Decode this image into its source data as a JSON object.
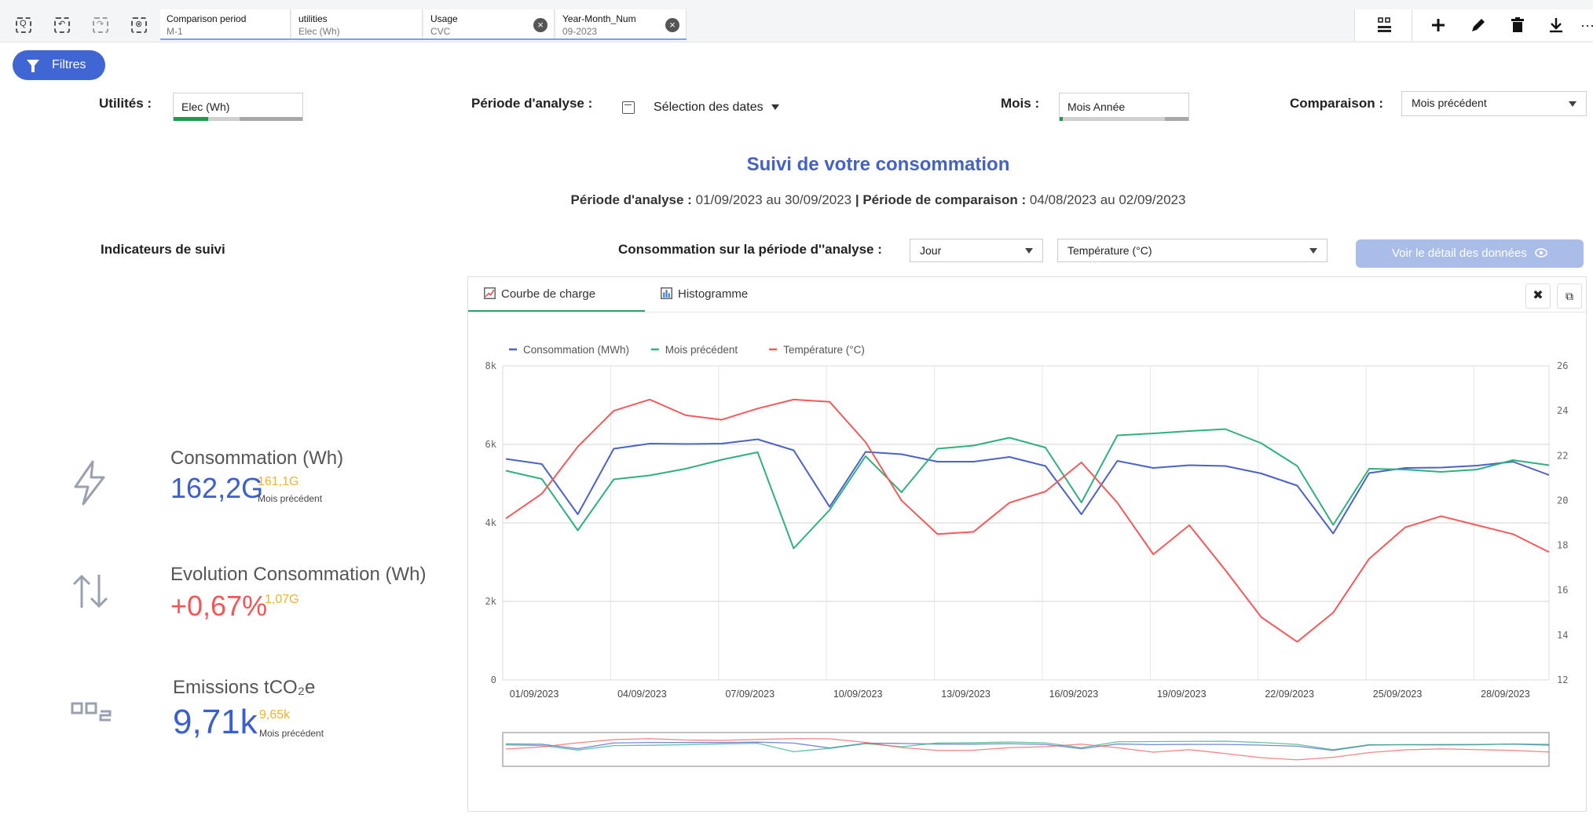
{
  "toolbar": {
    "chips": [
      {
        "key": "Comparison period",
        "value": "M-1",
        "closable": false
      },
      {
        "key": "utilities",
        "value": "Elec (Wh)",
        "closable": false
      },
      {
        "key": "Usage",
        "value": "CVC",
        "closable": true
      },
      {
        "key": "Year-Month_Num",
        "value": "09-2023",
        "closable": true
      }
    ],
    "right_icons": [
      "bookmark-grid-icon",
      "plus-icon",
      "pencil-icon",
      "trash-icon",
      "download-icon",
      "more-icon"
    ],
    "more_glyph": "···"
  },
  "filters_button": {
    "label": "Filtres"
  },
  "filter_row": {
    "utilities_label": "Utilités :",
    "utilities_value": "Elec (Wh)",
    "period_label": "Période d'analyse :",
    "period_value": "Sélection des dates",
    "month_label": "Mois :",
    "month_value": "Mois Année",
    "comparison_label": "Comparaison :",
    "comparison_value": "Mois précédent"
  },
  "header": {
    "title": "Suivi de votre consommation",
    "analysis_label": "Période d'analyse :",
    "analysis_range": "01/09/2023 au 30/09/2023",
    "separator": "|",
    "comparison_label": "Période de comparaison :",
    "comparison_range": "04/08/2023 au 02/09/2023"
  },
  "indicators": {
    "section_title": "Indicateurs de suivi",
    "kpis": [
      {
        "title": "Consommation (Wh)",
        "value": "162,2G",
        "value_color": "#3b5fcf",
        "compare": "161,1G",
        "sub": "Mois précédent",
        "icon": "lightning-icon"
      },
      {
        "title": "Evolution Consommation (Wh)",
        "value": "+0,67%",
        "value_color": "#f25656",
        "compare": "1,07G",
        "sub": "",
        "icon": "arrows-up-down-icon"
      },
      {
        "title": "Emissions tCO₂e",
        "value": "9,71k",
        "value_color": "#3b5fcf",
        "compare": "9,65k",
        "sub": "Mois précédent",
        "icon": "co2-icon"
      }
    ]
  },
  "controls": {
    "consumption_label": "Consommation sur la période d''analyse :",
    "granularity": "Jour",
    "second_metric": "Température (°C)",
    "detail_button": "Voir le détail des données"
  },
  "tabs": [
    {
      "label": "Courbe de charge",
      "active": true
    },
    {
      "label": "Histogramme",
      "active": false
    }
  ],
  "colors": {
    "accent": "#3f66d2",
    "consumption": "#4a63c4",
    "previous": "#2fb07f",
    "temperature": "#f25a5a",
    "tab_active": "#2fa36b"
  },
  "chart_data": {
    "type": "line",
    "x": [
      "01/09/2023",
      "02/09/2023",
      "03/09/2023",
      "04/09/2023",
      "05/09/2023",
      "06/09/2023",
      "07/09/2023",
      "08/09/2023",
      "09/09/2023",
      "10/09/2023",
      "11/09/2023",
      "12/09/2023",
      "13/09/2023",
      "14/09/2023",
      "15/09/2023",
      "16/09/2023",
      "17/09/2023",
      "18/09/2023",
      "19/09/2023",
      "20/09/2023",
      "21/09/2023",
      "22/09/2023",
      "23/09/2023",
      "24/09/2023",
      "25/09/2023",
      "26/09/2023",
      "27/09/2023",
      "28/09/2023",
      "29/09/2023",
      "30/09/2023"
    ],
    "x_ticks": [
      "01/09/2023",
      "04/09/2023",
      "07/09/2023",
      "10/09/2023",
      "13/09/2023",
      "16/09/2023",
      "19/09/2023",
      "22/09/2023",
      "25/09/2023",
      "28/09/2023"
    ],
    "y_ticks_left": [
      "0",
      "2k",
      "4k",
      "6k",
      "8k"
    ],
    "y_ticks_right": [
      "12",
      "14",
      "16",
      "18",
      "20",
      "22",
      "24",
      "26"
    ],
    "ylim_left": [
      0,
      8000
    ],
    "ylim_right": [
      12,
      26
    ],
    "legend_position": "top-left",
    "grid": true,
    "series": [
      {
        "name": "Consommation (MWh)",
        "axis": "left",
        "color": "#4a63c4",
        "values": [
          5630,
          5500,
          4220,
          5890,
          6020,
          6010,
          6020,
          6130,
          5850,
          4410,
          5810,
          5750,
          5560,
          5560,
          5680,
          5450,
          4220,
          5580,
          5400,
          5470,
          5450,
          5260,
          4950,
          3730,
          5270,
          5400,
          5410,
          5460,
          5560,
          5220
        ]
      },
      {
        "name": "Mois précédent",
        "axis": "left",
        "color": "#2fb07f",
        "values": [
          5330,
          5120,
          3810,
          5110,
          5210,
          5380,
          5610,
          5800,
          3350,
          4330,
          5700,
          4780,
          5890,
          5970,
          6170,
          5920,
          4520,
          6230,
          6280,
          6340,
          6390,
          6030,
          5450,
          3950,
          5380,
          5360,
          5300,
          5360,
          5600,
          5470
        ]
      },
      {
        "name": "Température (°C)",
        "axis": "right",
        "color": "#f25a5a",
        "values": [
          19.2,
          20.3,
          22.4,
          24.0,
          24.5,
          23.8,
          23.6,
          24.1,
          24.5,
          24.4,
          22.6,
          20.0,
          18.5,
          18.6,
          19.9,
          20.4,
          21.7,
          19.9,
          17.6,
          18.9,
          16.9,
          14.8,
          13.7,
          15.0,
          17.4,
          18.8,
          19.3,
          18.9,
          18.5,
          17.7
        ]
      }
    ]
  }
}
